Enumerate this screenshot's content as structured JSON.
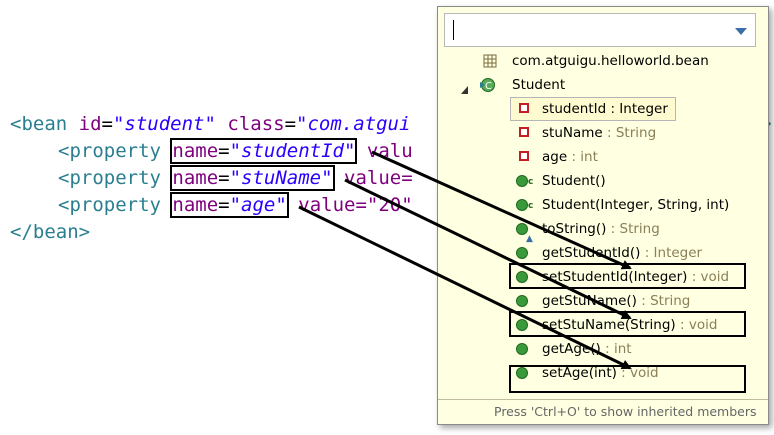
{
  "code": {
    "line1": {
      "open": "<bean ",
      "id_attr": "id",
      "eq": "=",
      "id_val": "\"student\"",
      "class_attr": " class",
      "class_eq": "=",
      "class_val": "\"com.atgui"
    },
    "props": [
      {
        "tag": "<property ",
        "name_attr": "name",
        "eq": "=",
        "name_val": "\"studentId\"",
        "tail": " valu"
      },
      {
        "tag": "<property ",
        "name_attr": "name",
        "eq": "=",
        "name_val": "\"stuName\"",
        "tail": " value="
      },
      {
        "tag": "<property ",
        "name_attr": "name",
        "eq": "=",
        "name_val": "\"age\"",
        "tail": " value=\"20\""
      }
    ],
    "close": "</bean>"
  },
  "outline": {
    "package": "com.atguigu.helloworld.bean",
    "class": "Student",
    "members": [
      {
        "name": "studentId",
        "type": " : Integer",
        "icon": "private-field-icon"
      },
      {
        "name": "stuName",
        "type": " : String",
        "icon": "private-field-icon"
      },
      {
        "name": "age",
        "type": " : int",
        "icon": "private-field-icon"
      },
      {
        "name": "Student()",
        "type": "",
        "icon": "constructor-icon"
      },
      {
        "name": "Student(Integer, String, int)",
        "type": "",
        "icon": "constructor-icon"
      },
      {
        "name": "toString()",
        "type": " : String",
        "icon": "override-method-icon"
      },
      {
        "name": "getStudentId()",
        "type": " : Integer",
        "icon": "public-method-icon"
      },
      {
        "name": "setStudentId(Integer)",
        "type": " : void",
        "icon": "public-method-icon"
      },
      {
        "name": "getStuName()",
        "type": " : String",
        "icon": "public-method-icon"
      },
      {
        "name": "setStuName(String)",
        "type": " : void",
        "icon": "public-method-icon"
      },
      {
        "name": "getAge()",
        "type": " : int",
        "icon": "public-method-icon"
      },
      {
        "name": "setAge(int)",
        "type": " : void",
        "icon": "public-method-icon"
      }
    ],
    "status": "Press 'Ctrl+O' to show inherited members"
  }
}
